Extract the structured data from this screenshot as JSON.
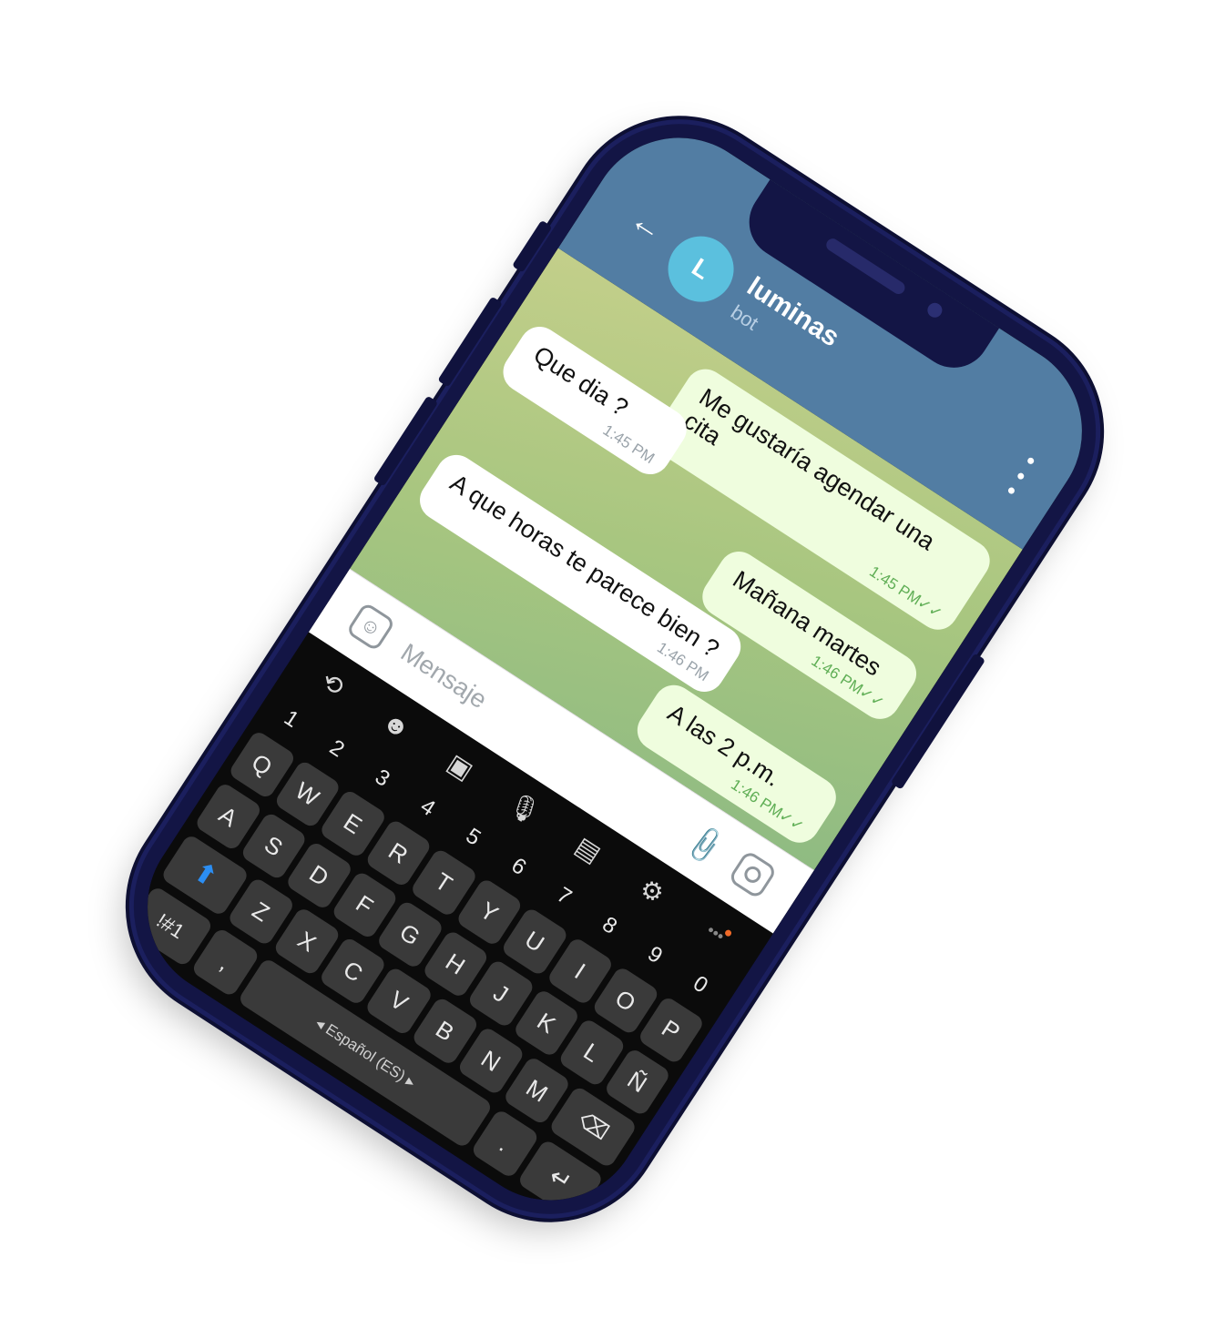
{
  "header": {
    "back_icon": "arrow-left-icon",
    "avatar_letter": "L",
    "title": "luminas",
    "subtitle": "bot",
    "menu_icon": "kebab-menu-icon",
    "bg_color": "#527da3"
  },
  "messages": [
    {
      "direction": "out",
      "text": "Me gustaría agendar una cita",
      "time": "1:45 PM",
      "status": "double-check"
    },
    {
      "direction": "in",
      "text": "Que dia ?",
      "time": "1:45 PM"
    },
    {
      "direction": "out",
      "text": "Mañana martes",
      "time": "1:46 PM",
      "status": "double-check"
    },
    {
      "direction": "in",
      "text": "A que horas te parece bien ?",
      "time": "1:46 PM"
    },
    {
      "direction": "out",
      "text": "A las 2 p.m.",
      "time": "1:46 PM",
      "status": "double-check"
    }
  ],
  "input": {
    "placeholder": "Mensaje",
    "value": ""
  },
  "keyboard": {
    "language": "◂  Español (ES)  ▸",
    "numbers": [
      "1",
      "2",
      "3",
      "4",
      "5",
      "6",
      "7",
      "8",
      "9",
      "0"
    ],
    "row1": [
      "Q",
      "W",
      "E",
      "R",
      "T",
      "Y",
      "U",
      "I",
      "O",
      "P"
    ],
    "row2": [
      "A",
      "S",
      "D",
      "F",
      "G",
      "H",
      "J",
      "K",
      "L",
      "Ñ"
    ],
    "row3": [
      "Z",
      "X",
      "C",
      "V",
      "B",
      "N",
      "M"
    ],
    "symbols_label": "!#1",
    "comma": ",",
    "period": ".",
    "colors": {
      "shift": "#2b8ef3",
      "dot_indicator": "#f06a28"
    }
  }
}
